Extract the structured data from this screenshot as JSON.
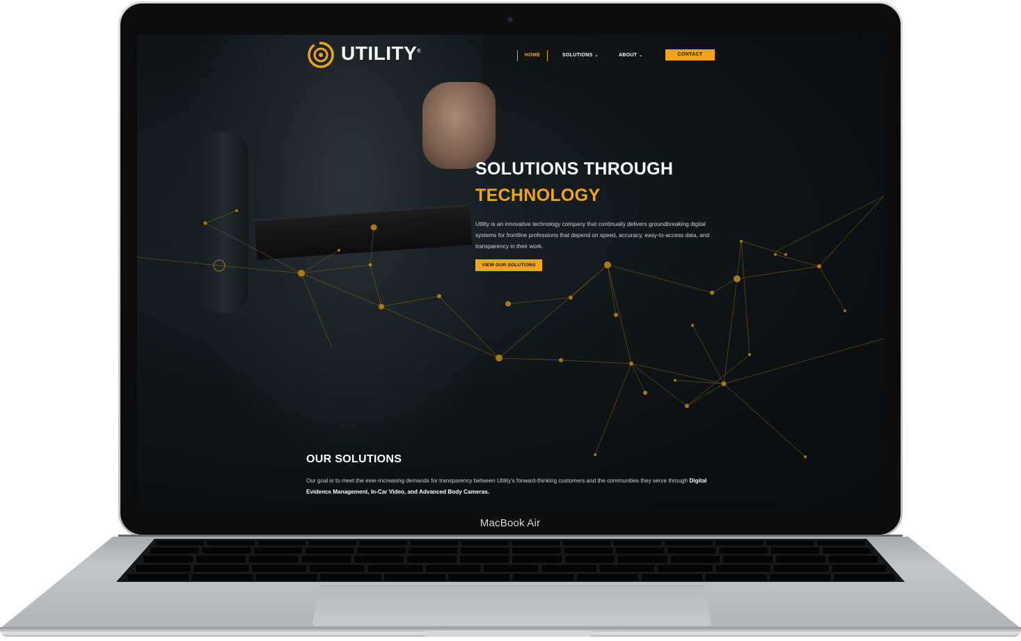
{
  "device": {
    "label": "MacBook Air"
  },
  "brand": {
    "name": "UTILITY",
    "trademark": "®"
  },
  "nav": {
    "items": [
      {
        "label": "HOME",
        "active": true
      },
      {
        "label": "SOLUTIONS",
        "has_dropdown": true
      },
      {
        "label": "ABOUT",
        "has_dropdown": true
      }
    ],
    "contact_label": "CONTACT",
    "dropdown_icon": "chevron-down-icon"
  },
  "hero": {
    "title_line1": "SOLUTIONS THROUGH",
    "title_line2": "TECHNOLOGY",
    "paragraph": "Utility is an innovative technology company that continually delivers groundbreaking digital systems for frontline professions that depend on speed, accuracy, easy-to-access data, and transparency in their work.",
    "button_label": "VIEW OUR SOLUTIONS"
  },
  "solutions": {
    "title": "OUR SOLUTIONS",
    "paragraph_start": "Our goal is to meet the ever-increasing demands for transparency between Utility's forward-thinking customers and the communities they serve through ",
    "paragraph_bold": "Digital Evidence Management, In-Car Video, and Advanced Body Cameras."
  },
  "colors": {
    "accent": "#f2a516",
    "background": "#0f1315",
    "text": "#ffffff"
  }
}
